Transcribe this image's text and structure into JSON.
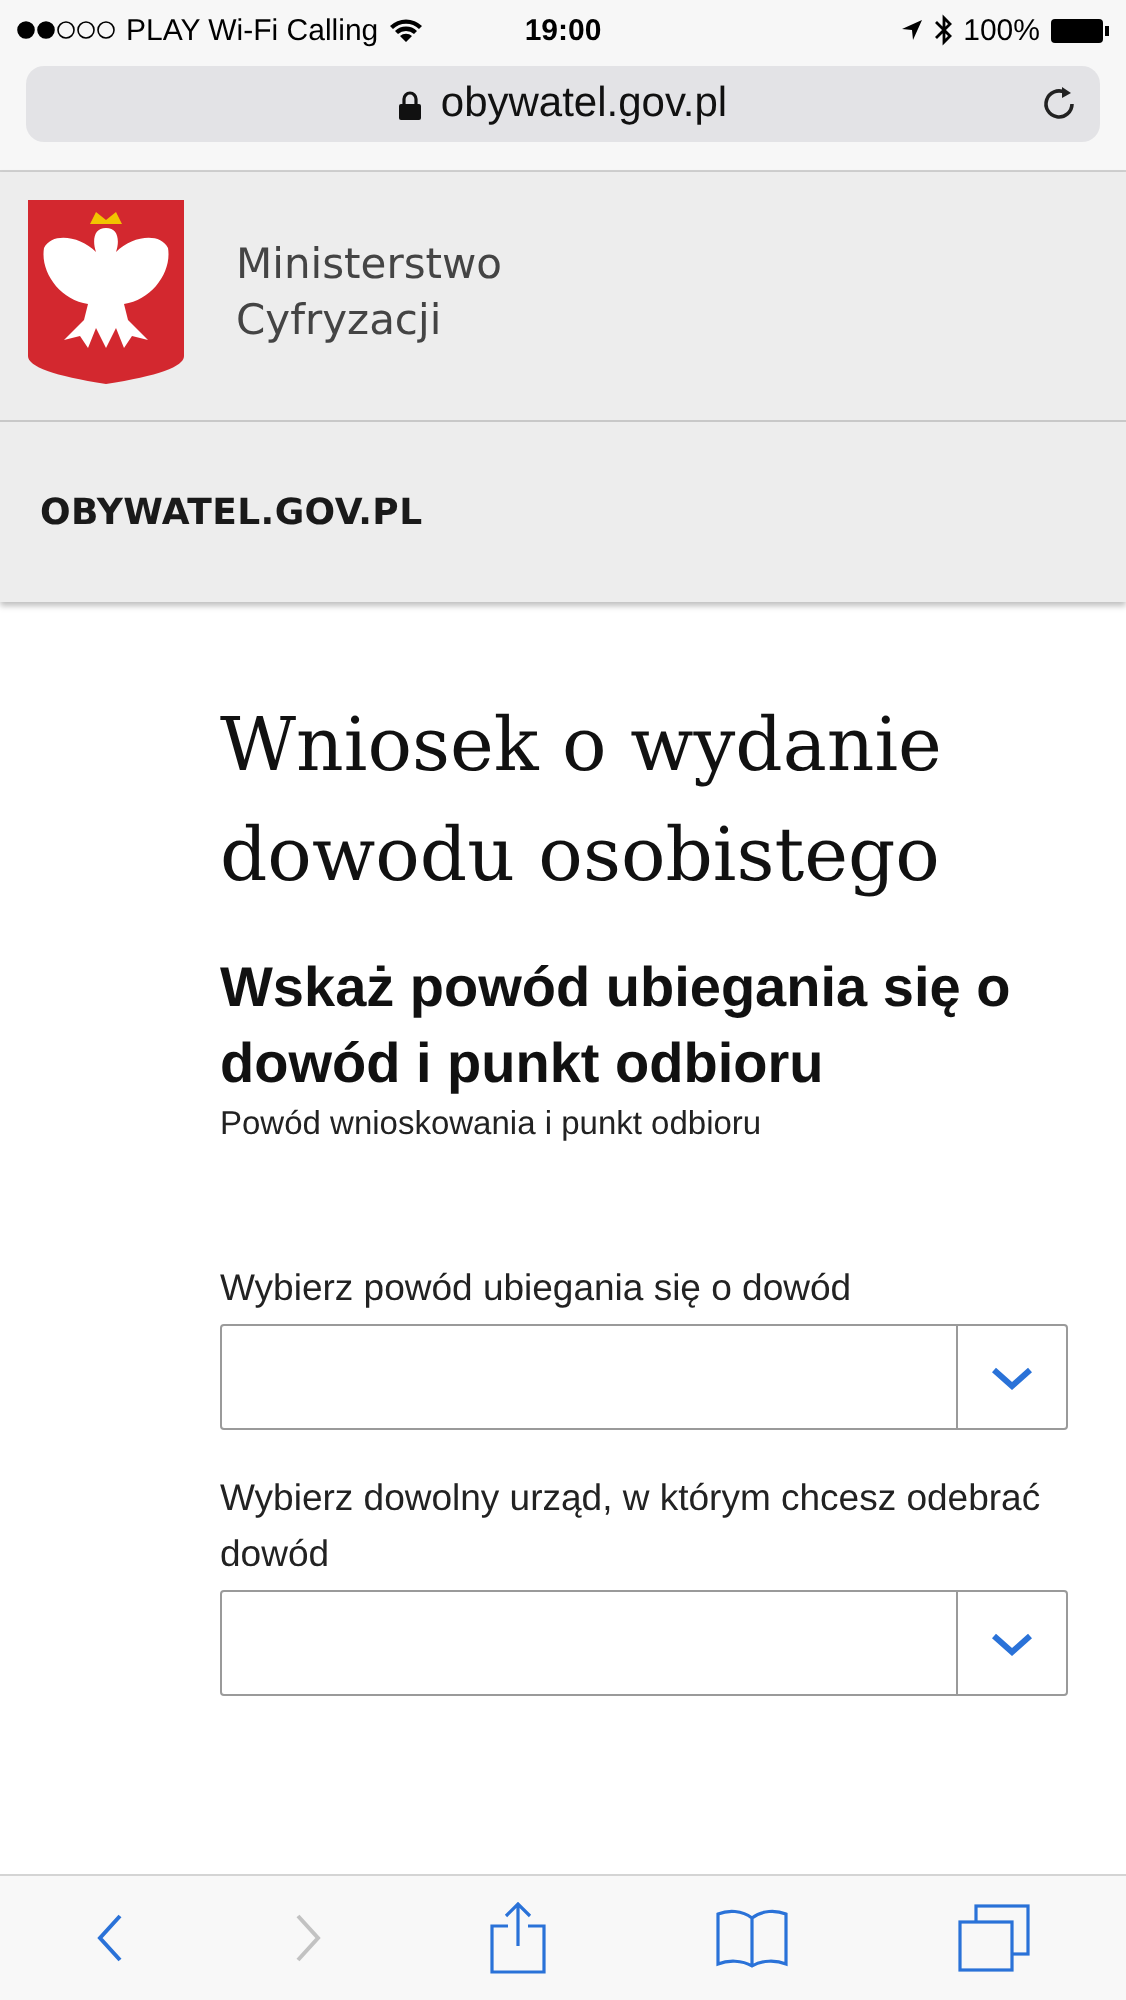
{
  "status_bar": {
    "carrier": "PLAY Wi-Fi Calling",
    "time": "19:00",
    "battery": "100%"
  },
  "address_bar": {
    "url": "obywatel.gov.pl"
  },
  "header": {
    "ministry_lines": [
      "Ministerstwo",
      "Cyfryzacji"
    ],
    "site_name": "OBYWATEL.GOV.PL"
  },
  "page": {
    "title": "Wniosek o wydanie dowodu osobistego",
    "section_heading": "Wskaż powód ubiegania się o dowód i punkt odbioru",
    "section_subtitle": "Powód wnioskowania i punkt odbioru",
    "fields": [
      {
        "label": "Wybierz powód ubiegania się o dowód"
      },
      {
        "label": "Wybierz dowolny urząd, w którym chcesz odebrać dowód"
      }
    ]
  },
  "toolbar": {
    "back_disabled": false,
    "forward_disabled": true
  }
}
